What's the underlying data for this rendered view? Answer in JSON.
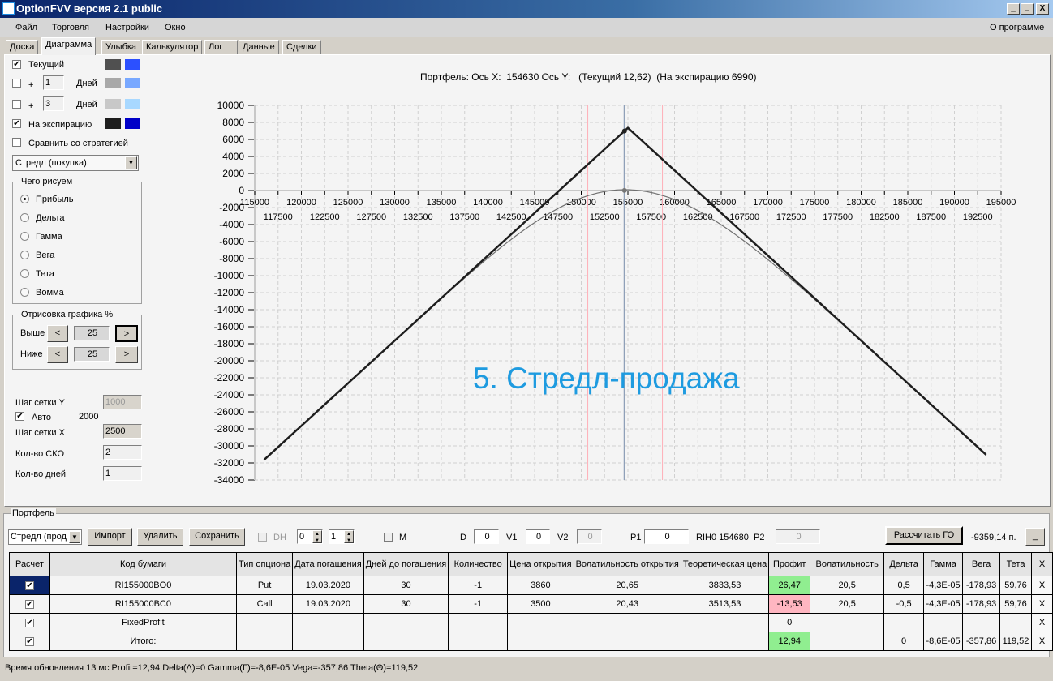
{
  "window": {
    "title": "OptionFVV версия 2.1 public",
    "minimize": "_",
    "maximize": "□",
    "close": "X"
  },
  "menu": {
    "items": [
      "Файл",
      "Торговля",
      "Настройки",
      "Окно"
    ],
    "about": "О программе"
  },
  "tabs": [
    {
      "label": "Доска"
    },
    {
      "label": "Диаграмма",
      "active": true
    },
    {
      "label": "Улыбка"
    },
    {
      "label": "Калькулятор"
    },
    {
      "label": "Лог"
    },
    {
      "label": "Данные"
    },
    {
      "label": "Сделки"
    }
  ],
  "left": {
    "current": {
      "label": "Текущий",
      "checked": true,
      "colors": [
        "#505050",
        "#2c50ff"
      ]
    },
    "plus1": {
      "plus": "+",
      "value": "1",
      "unit": "Дней",
      "checked": false,
      "colors": [
        "#a8a8a8",
        "#78a8ff"
      ]
    },
    "plus3": {
      "plus": "+",
      "value": "3",
      "unit": "Дней",
      "checked": false,
      "colors": [
        "#c8c8c8",
        "#a8d8ff"
      ]
    },
    "expiry": {
      "label": "На экспирацию",
      "checked": true,
      "colors": [
        "#1e1e1e",
        "#0000c8"
      ]
    },
    "compare": {
      "label": "Сравнить со стратегией",
      "checked": false
    },
    "strategy_select": "Стредл (покупка).",
    "draw_group": {
      "title": "Чего рисуем",
      "options": [
        "Прибыль",
        "Дельта",
        "Гамма",
        "Вега",
        "Тета",
        "Вомма"
      ],
      "selected": "Прибыль"
    },
    "render_group": {
      "title": "Отрисовка графика %",
      "above_label": "Выше",
      "above": "25",
      "below_label": "Ниже",
      "below": "25",
      "prev": "<",
      "next": ">"
    },
    "grid_y_label": "Шаг сетки Y",
    "grid_y": "1000",
    "auto_label": "Авто",
    "auto_checked": true,
    "auto_value": "2000",
    "grid_x_label": "Шаг сетки X",
    "grid_x": "2500",
    "sko_label": "Кол-во СКО",
    "sko": "2",
    "days_label": "Кол-во дней",
    "days": "1"
  },
  "chart_data": {
    "type": "line",
    "title": "Портфель: Ось X:  154630 Ось Y:   (Текущий 12,62)  (На экспирацию 6990)",
    "annotation": "5. Стредл-продажа",
    "xlim": [
      115000,
      195000
    ],
    "ylim": [
      -34000,
      10000
    ],
    "x_ticks_major": [
      115000,
      120000,
      125000,
      130000,
      135000,
      140000,
      145000,
      150000,
      155000,
      160000,
      165000,
      170000,
      175000,
      180000,
      185000,
      190000,
      195000
    ],
    "x_ticks_minor": [
      117500,
      122500,
      127500,
      132500,
      137500,
      142500,
      147500,
      152500,
      157500,
      162500,
      167500,
      172500,
      177500,
      182500,
      187500,
      192500
    ],
    "y_ticks": [
      10000,
      8000,
      6000,
      4000,
      2000,
      0,
      -2000,
      -4000,
      -6000,
      -8000,
      -10000,
      -12000,
      -14000,
      -16000,
      -18000,
      -20000,
      -22000,
      -24000,
      -26000,
      -28000,
      -30000,
      -32000,
      -34000
    ],
    "grid": true,
    "series": [
      {
        "id": "expiry",
        "color": "#1e1e1e",
        "points": [
          [
            116000,
            -31640
          ],
          [
            155000,
            7360
          ],
          [
            193400,
            -31040
          ]
        ]
      },
      {
        "id": "current",
        "color": "#707070",
        "strike": 155000,
        "premium": 7360,
        "vol": 20.5,
        "days": 30,
        "xrange": [
          116000,
          193400
        ]
      }
    ],
    "current_price": 154630,
    "current_point": {
      "x": 154630,
      "y_expiry": 6990,
      "y_current": 12.62
    },
    "sigma_lines": [
      150700,
      158700
    ],
    "colors": {
      "price_line": "#8fa0b8",
      "sigma_line": "#ffb0b8",
      "annotation": "#1e9be0"
    }
  },
  "portfolio": {
    "title": "Портфель",
    "strategy": "Стредл (прод",
    "import": "Импорт",
    "delete": "Удалить",
    "save": "Сохранить",
    "dh_label": "DH",
    "spin1": "0",
    "spin2": "1",
    "m_label": "M",
    "d_label": "D",
    "d": "0",
    "v1_label": "V1",
    "v1": "0",
    "v2_label": "V2",
    "v2": "0",
    "p1_label": "P1",
    "p1": "0",
    "rih": "RIH0 154680",
    "p2_label": "P2",
    "p2": "0",
    "calc_go": "Рассчитать ГО",
    "go_value": "-9359,14 п.",
    "min_btn": "_",
    "columns": [
      "Расчет",
      "Код бумаги",
      "Тип опциона",
      "Дата погашения",
      "Дней до погашения",
      "Количество",
      "Цена открытия",
      "Волатильность открытия",
      "Теоретическая цена",
      "Профит",
      "Волатильность",
      "Дельта",
      "Гамма",
      "Вега",
      "Тета",
      "X"
    ],
    "rows": [
      {
        "code": "RI155000BO0",
        "type": "Put",
        "date": "19.03.2020",
        "days": "30",
        "qty": "-1",
        "price": "3860",
        "vol_open": "20,65",
        "theo": "3833,53",
        "profit": "26,47",
        "profit_color": "#90ee90",
        "vol": "20,5",
        "delta": "0,5",
        "gamma": "-4,3E-05",
        "vega": "-178,93",
        "theta": "59,76",
        "del": "X"
      },
      {
        "code": "RI155000BC0",
        "type": "Call",
        "date": "19.03.2020",
        "days": "30",
        "qty": "-1",
        "price": "3500",
        "vol_open": "20,43",
        "theo": "3513,53",
        "profit": "-13,53",
        "profit_color": "#ffb6c1",
        "vol": "20,5",
        "delta": "-0,5",
        "gamma": "-4,3E-05",
        "vega": "-178,93",
        "theta": "59,76",
        "del": "X"
      },
      {
        "code": "FixedProfit",
        "type": "",
        "date": "",
        "days": "",
        "qty": "",
        "price": "",
        "vol_open": "",
        "theo": "",
        "profit": "0",
        "profit_color": "",
        "vol": "",
        "delta": "",
        "gamma": "",
        "vega": "",
        "theta": "",
        "del": "X"
      },
      {
        "code": "Итого:",
        "type": "",
        "date": "",
        "days": "",
        "qty": "",
        "price": "",
        "vol_open": "",
        "theo": "",
        "profit": "12,94",
        "profit_color": "#90ee90",
        "vol": "",
        "delta": "0",
        "gamma": "-8,6E-05",
        "vega": "-357,86",
        "theta": "119,52",
        "del": "X"
      }
    ]
  },
  "status": "Время обновления 13 мс  Profit=12,94 Delta(Δ)=0 Gamma(Γ)=-8,6E-05 Vega=-357,86 Theta(Θ)=119,52"
}
